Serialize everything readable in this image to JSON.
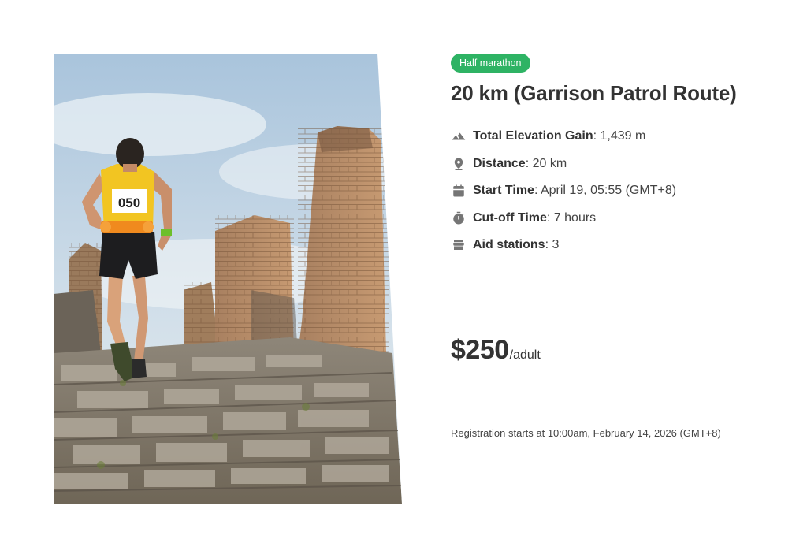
{
  "event": {
    "badge": "Half marathon",
    "badge_color": "#2eb364",
    "title": "20 km (Garrison Patrol Route)"
  },
  "facts": [
    {
      "icon": "mountain-icon",
      "label": "Total Elevation Gain",
      "sep": ": ",
      "value": "1,439 m"
    },
    {
      "icon": "map-pin-icon",
      "label": "Distance",
      "sep": ": ",
      "value": "20 km"
    },
    {
      "icon": "calendar-icon",
      "label": "Start Time",
      "sep": ": ",
      "value": "April 19, 05:55 (GMT+8)"
    },
    {
      "icon": "stopwatch-icon",
      "label": "Cut-off Time",
      "sep": ": ",
      "value": "7 hours"
    },
    {
      "icon": "store-icon",
      "label": "Aid stations",
      "sep": ": ",
      "value": "3"
    }
  ],
  "price": {
    "amount": "$250",
    "unit": "/adult"
  },
  "registration": {
    "text": "Registration starts at 10:00am, February 14, 2026 (GMT+8)"
  },
  "photo": {
    "bib_number": "050"
  }
}
